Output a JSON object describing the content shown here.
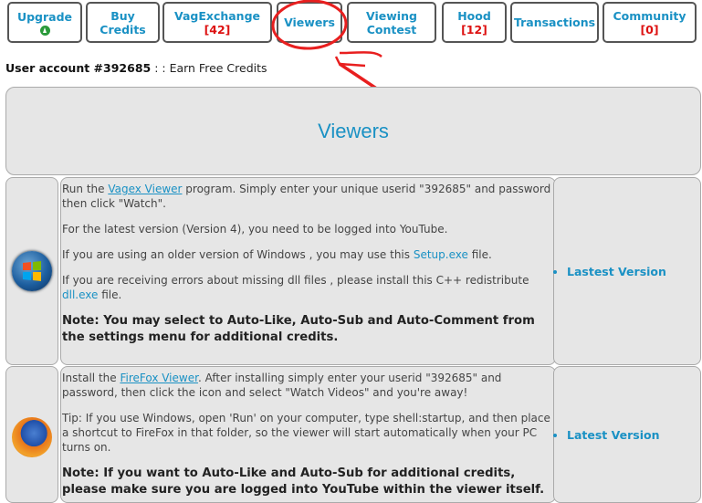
{
  "nav": {
    "tabs": [
      {
        "label": "Upgrade",
        "count": "",
        "name": "tab-upgrade"
      },
      {
        "label": "Buy Credits",
        "count": "",
        "name": "tab-buy-credits"
      },
      {
        "label": "VagExchange",
        "count": "[42]",
        "name": "tab-vagexchange"
      },
      {
        "label": "Viewers",
        "count": "",
        "name": "tab-viewers"
      },
      {
        "label": "Viewing Contest",
        "count": "",
        "name": "tab-viewing-contest"
      },
      {
        "label": "Hood",
        "count": "[12]",
        "name": "tab-hood"
      },
      {
        "label": "Transactions",
        "count": "",
        "name": "tab-transactions"
      },
      {
        "label": "Community",
        "count": "[0]",
        "name": "tab-community"
      }
    ]
  },
  "account": {
    "label": "User account #392685",
    "separator": " : : ",
    "subtitle": "Earn Free Credits"
  },
  "page": {
    "title": "Viewers"
  },
  "sections": [
    {
      "icon": "windows-logo-icon",
      "p1_pre": "Run the ",
      "p1_link": "Vagex Viewer",
      "p1_post": " program. Simply enter your unique userid \"392685\" and password then click \"Watch\".",
      "p2": "For the latest version (Version 4), you need to be logged into YouTube.",
      "p3_pre": "If you are using an older version of Windows , you may use this ",
      "p3_link": "Setup.exe",
      "p3_post": " file.",
      "p4_pre": "If you are receiving errors about missing dll files , please install this C++ redistribute ",
      "p4_link": "dll.exe",
      "p4_post": " file.",
      "note": "Note: You may select to Auto-Like, Auto-Sub and Auto-Comment from the settings menu for additional credits.",
      "side_link": "Lastest Version"
    },
    {
      "icon": "firefox-logo-icon",
      "p1_pre": "Install the ",
      "p1_link": "FireFox Viewer",
      "p1_post": ". After installing simply enter your userid \"392685\" and password, then click the icon and select \"Watch Videos\" and you're away!",
      "p2": "Tip: If you use Windows, open 'Run' on your computer, type shell:startup, and then place a shortcut to FireFox in that folder, so the viewer will start automatically when your PC turns on.",
      "note": "Note: If you want to Auto-Like and Auto-Sub for additional credits, please make sure you are logged into YouTube within the viewer itself.",
      "side_link": "Latest Version"
    }
  ]
}
